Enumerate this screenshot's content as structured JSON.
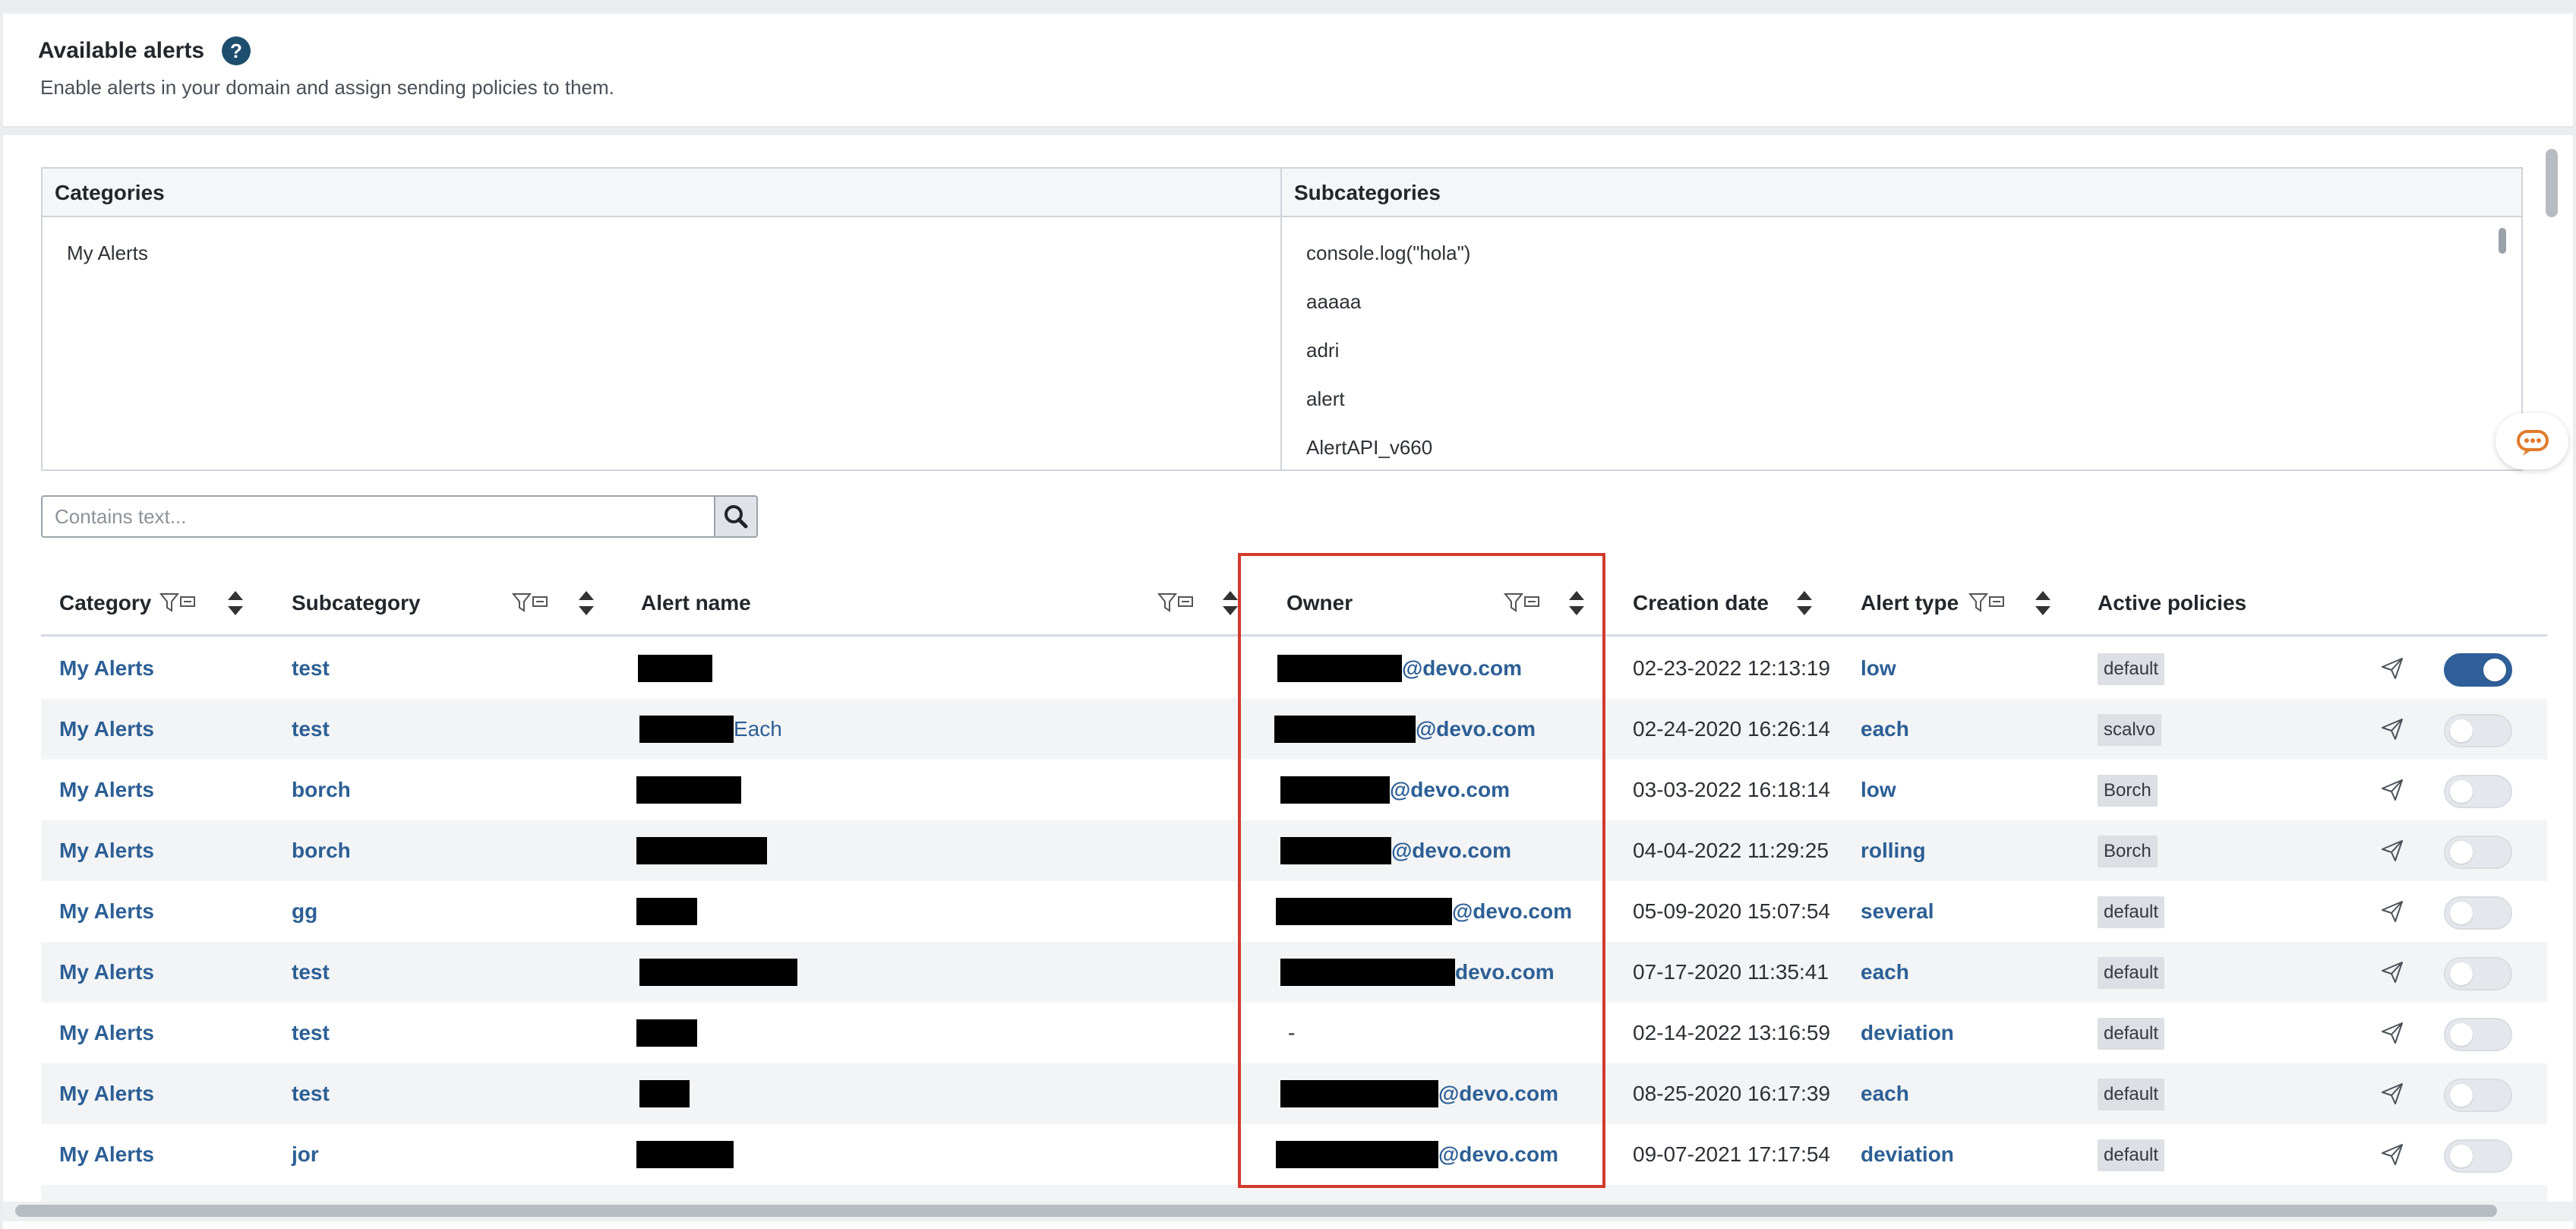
{
  "header": {
    "title": "Available alerts",
    "subtitle": "Enable alerts in your domain and assign sending policies to them.",
    "help_icon": "help-icon"
  },
  "categories_panel": {
    "categories_header": "Categories",
    "subcategories_header": "Subcategories",
    "categories": [
      "My Alerts"
    ],
    "subcategories": [
      "console.log(\"hola\")",
      "aaaaa",
      "adri",
      "alert",
      "AlertAPI_v660"
    ]
  },
  "search": {
    "placeholder": "Contains text...",
    "value": "",
    "icon": "search-icon"
  },
  "table": {
    "columns": {
      "category": "Category",
      "subcategory": "Subcategory",
      "alert_name": "Alert name",
      "owner": "Owner",
      "creation_date": "Creation date",
      "alert_type": "Alert type",
      "active_policies": "Active policies"
    },
    "rows": [
      {
        "category": "My Alerts",
        "subcategory": "test",
        "alert_name_suffix": "",
        "owner_suffix": "@devo.com",
        "creation_date": "02-23-2022 12:13:19",
        "alert_type": "low",
        "policy": "default",
        "enabled": true
      },
      {
        "category": "My Alerts",
        "subcategory": "test",
        "alert_name_suffix": "Each",
        "owner_suffix": "@devo.com",
        "creation_date": "02-24-2020 16:26:14",
        "alert_type": "each",
        "policy": "scalvo",
        "enabled": false
      },
      {
        "category": "My Alerts",
        "subcategory": "borch",
        "alert_name_suffix": "",
        "owner_suffix": "@devo.com",
        "creation_date": "03-03-2022 16:18:14",
        "alert_type": "low",
        "policy": "Borch",
        "enabled": false
      },
      {
        "category": "My Alerts",
        "subcategory": "borch",
        "alert_name_suffix": "",
        "owner_suffix": "@devo.com",
        "creation_date": "04-04-2022 11:29:25",
        "alert_type": "rolling",
        "policy": "Borch",
        "enabled": false
      },
      {
        "category": "My Alerts",
        "subcategory": "gg",
        "alert_name_suffix": "",
        "owner_suffix": "@devo.com",
        "creation_date": "05-09-2020 15:07:54",
        "alert_type": "several",
        "policy": "default",
        "enabled": false
      },
      {
        "category": "My Alerts",
        "subcategory": "test",
        "alert_name_suffix": "",
        "owner_suffix": "devo.com",
        "creation_date": "07-17-2020 11:35:41",
        "alert_type": "each",
        "policy": "default",
        "enabled": false
      },
      {
        "category": "My Alerts",
        "subcategory": "test",
        "alert_name_suffix": "",
        "owner_suffix": "-",
        "creation_date": "02-14-2022 13:16:59",
        "alert_type": "deviation",
        "policy": "default",
        "enabled": false
      },
      {
        "category": "My Alerts",
        "subcategory": "test",
        "alert_name_suffix": "",
        "owner_suffix": "@devo.com",
        "creation_date": "08-25-2020 16:17:39",
        "alert_type": "each",
        "policy": "default",
        "enabled": false
      },
      {
        "category": "My Alerts",
        "subcategory": "jor",
        "alert_name_suffix": "",
        "owner_suffix": "@devo.com",
        "creation_date": "09-07-2021 17:17:54",
        "alert_type": "deviation",
        "policy": "default",
        "enabled": false
      }
    ]
  },
  "colors": {
    "link": "#2c5f95",
    "toggle_on": "#2f5f99",
    "highlight": "#d23a2c",
    "chat_icon": "#e07b2a"
  }
}
